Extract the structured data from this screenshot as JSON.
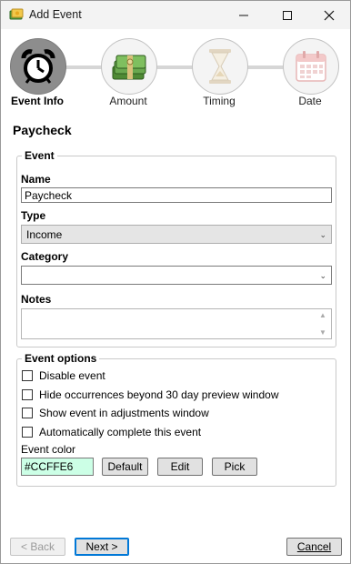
{
  "window": {
    "title": "Add Event"
  },
  "accent": "#CCFFE6",
  "steps": [
    {
      "label": "Event Info",
      "icon": "alarm-clock-icon",
      "active": true
    },
    {
      "label": "Amount",
      "icon": "money-stack-icon",
      "active": false
    },
    {
      "label": "Timing",
      "icon": "hourglass-icon",
      "active": false
    },
    {
      "label": "Date",
      "icon": "calendar-icon",
      "active": false
    }
  ],
  "heading": "Paycheck",
  "event": {
    "legend": "Event",
    "name_label": "Name",
    "name_value": "Paycheck",
    "type_label": "Type",
    "type_value": "Income",
    "category_label": "Category",
    "category_value": "",
    "notes_label": "Notes",
    "notes_value": ""
  },
  "options": {
    "legend": "Event options",
    "checkboxes": [
      {
        "label": "Disable event",
        "checked": false
      },
      {
        "label": "Hide occurrences beyond 30 day preview window",
        "checked": false
      },
      {
        "label": "Show event in adjustments window",
        "checked": false
      },
      {
        "label": "Automatically complete this event",
        "checked": false
      }
    ],
    "color_label": "Event color",
    "color_value": "#CCFFE6",
    "default_label": "Default",
    "edit_label": "Edit",
    "pick_label": "Pick"
  },
  "footer": {
    "back_label": "< Back",
    "next_label": "Next >",
    "cancel_label": "Cancel"
  }
}
